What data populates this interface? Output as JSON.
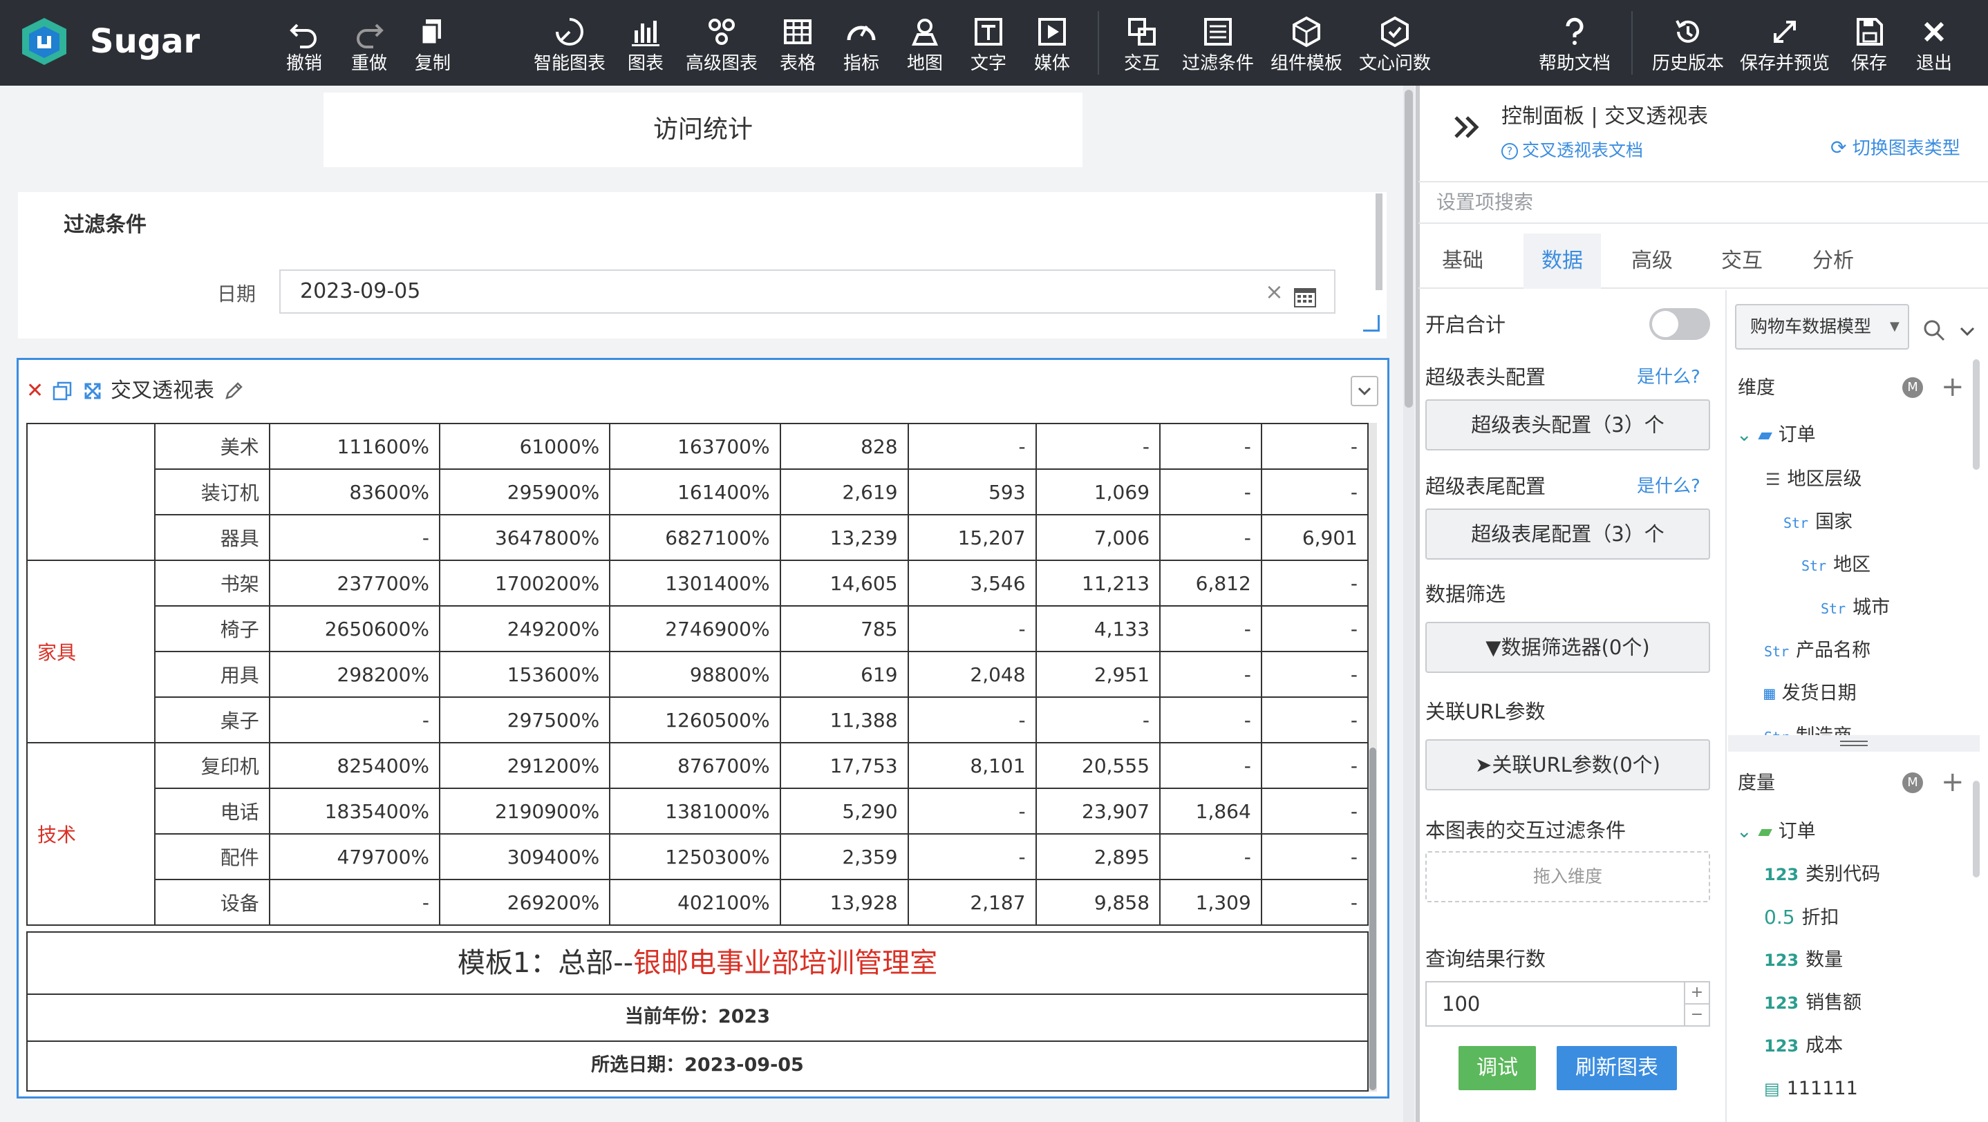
{
  "app": {
    "name": "Sugar"
  },
  "toolbar": {
    "items": [
      {
        "id": "undo",
        "label": "撤销",
        "icon": "undo-icon"
      },
      {
        "id": "redo",
        "label": "重做",
        "icon": "redo-icon"
      },
      {
        "id": "copy",
        "label": "复制",
        "icon": "copy-icon"
      },
      {
        "id": "smart-chart",
        "label": "智能图表",
        "icon": "smart-chart-icon"
      },
      {
        "id": "chart",
        "label": "图表",
        "icon": "bar-chart-icon"
      },
      {
        "id": "advanced-chart",
        "label": "高级图表",
        "icon": "advanced-chart-icon"
      },
      {
        "id": "table",
        "label": "表格",
        "icon": "table-icon"
      },
      {
        "id": "indicator",
        "label": "指标",
        "icon": "gauge-icon"
      },
      {
        "id": "map",
        "label": "地图",
        "icon": "map-pin-icon"
      },
      {
        "id": "text",
        "label": "文字",
        "icon": "text-icon"
      },
      {
        "id": "media",
        "label": "媒体",
        "icon": "media-icon"
      },
      {
        "id": "interact",
        "label": "交互",
        "icon": "interact-icon"
      },
      {
        "id": "filter",
        "label": "过滤条件",
        "icon": "filter-panel-icon"
      },
      {
        "id": "component-template",
        "label": "组件模板",
        "icon": "cube-icon"
      },
      {
        "id": "wenxin",
        "label": "文心问数",
        "icon": "wenxin-icon"
      },
      {
        "id": "help",
        "label": "帮助文档",
        "icon": "help-icon"
      },
      {
        "id": "history",
        "label": "历史版本",
        "icon": "history-icon"
      },
      {
        "id": "save-preview",
        "label": "保存并预览",
        "icon": "expand-icon"
      },
      {
        "id": "save",
        "label": "保存",
        "icon": "save-icon"
      },
      {
        "id": "exit",
        "label": "退出",
        "icon": "close-icon"
      }
    ]
  },
  "canvas": {
    "title": "访问统计",
    "filter": {
      "title": "过滤条件",
      "date_label": "日期",
      "date_value": "2023-09-05"
    },
    "chart": {
      "title": "交叉透视表"
    }
  },
  "pivot": {
    "rows": [
      {
        "category": "",
        "sub": "美术",
        "cells": [
          "111600%",
          "61000%",
          "163700%",
          "828",
          "-",
          "-",
          "-",
          "-"
        ]
      },
      {
        "category": "",
        "sub": "装订机",
        "cells": [
          "83600%",
          "295900%",
          "161400%",
          "2,619",
          "593",
          "1,069",
          "-",
          "-"
        ]
      },
      {
        "category": "",
        "sub": "器具",
        "cells": [
          "-",
          "3647800%",
          "6827100%",
          "13,239",
          "15,207",
          "7,006",
          "-",
          "6,901"
        ]
      },
      {
        "category": "家具",
        "sub": "书架",
        "cells": [
          "237700%",
          "1700200%",
          "1301400%",
          "14,605",
          "3,546",
          "11,213",
          "6,812",
          "-"
        ]
      },
      {
        "category": "",
        "sub": "椅子",
        "cells": [
          "2650600%",
          "249200%",
          "2746900%",
          "785",
          "-",
          "4,133",
          "-",
          "-"
        ]
      },
      {
        "category": "",
        "sub": "用具",
        "cells": [
          "298200%",
          "153600%",
          "98800%",
          "619",
          "2,048",
          "2,951",
          "-",
          "-"
        ]
      },
      {
        "category": "",
        "sub": "桌子",
        "cells": [
          "-",
          "297500%",
          "1260500%",
          "11,388",
          "-",
          "-",
          "-",
          "-"
        ]
      },
      {
        "category": "技术",
        "sub": "复印机",
        "cells": [
          "825400%",
          "291200%",
          "876700%",
          "17,753",
          "8,101",
          "20,555",
          "-",
          "-"
        ]
      },
      {
        "category": "",
        "sub": "电话",
        "cells": [
          "1835400%",
          "2190900%",
          "1381000%",
          "5,290",
          "-",
          "23,907",
          "1,864",
          "-"
        ]
      },
      {
        "category": "",
        "sub": "配件",
        "cells": [
          "479700%",
          "309400%",
          "1250300%",
          "2,359",
          "-",
          "2,895",
          "-",
          "-"
        ]
      },
      {
        "category": "",
        "sub": "设备",
        "cells": [
          "-",
          "269200%",
          "402100%",
          "13,928",
          "2,187",
          "9,858",
          "1,309",
          "-"
        ]
      }
    ],
    "footer": {
      "template_prefix": "模板1：总部--",
      "template_highlight": "银邮电事业部培训管理室",
      "year_line": "当前年份：2023",
      "date_line": "所选日期：2023-09-05"
    }
  },
  "panel": {
    "title": "控制面板 | 交叉透视表",
    "doc_link": "交叉透视表文档",
    "switch_type": "切换图表类型",
    "search_placeholder": "设置项搜索",
    "tabs": [
      "基础",
      "数据",
      "高级",
      "交互",
      "分析"
    ],
    "active_tab": "数据",
    "enable_total": "开启合计",
    "super_header": {
      "label": "超级表头配置",
      "what": "是什么?",
      "button": "超级表头配置（3）个"
    },
    "super_footer": {
      "label": "超级表尾配置",
      "what": "是什么?",
      "button": "超级表尾配置（3）个"
    },
    "data_filter": {
      "label": "数据筛选",
      "button": "数据筛选器(0个)"
    },
    "url_params": {
      "label": "关联URL参数",
      "button": "关联URL参数(0个)"
    },
    "interact_filter": {
      "label": "本图表的交互过滤条件",
      "drop_hint": "拖入维度"
    },
    "query_rows": {
      "label": "查询结果行数",
      "value": "100",
      "plus": "+",
      "minus": "−"
    },
    "debug_button": "调试",
    "refresh_button": "刷新图表",
    "model": "购物车数据模型",
    "dimension": {
      "title": "维度",
      "folder": "订单",
      "items": [
        {
          "type": "hier",
          "label": "地区层级",
          "indent": 0
        },
        {
          "type": "Str",
          "label": "国家",
          "indent": 1
        },
        {
          "type": "Str",
          "label": "地区",
          "indent": 2
        },
        {
          "type": "Str",
          "label": "城市",
          "indent": 3
        },
        {
          "type": "Str",
          "label": "产品名称",
          "indent": 0
        },
        {
          "type": "date",
          "label": "发货日期",
          "indent": 0
        },
        {
          "type": "Str",
          "label": "制造商",
          "indent": 0
        }
      ]
    },
    "measure": {
      "title": "度量",
      "folder": "订单",
      "items": [
        {
          "type": "123",
          "label": "类别代码"
        },
        {
          "type": "0.5",
          "label": "折扣"
        },
        {
          "type": "123",
          "label": "数量"
        },
        {
          "type": "123",
          "label": "销售额"
        },
        {
          "type": "123",
          "label": "成本"
        },
        {
          "type": "calc",
          "label": "111111"
        }
      ]
    }
  }
}
